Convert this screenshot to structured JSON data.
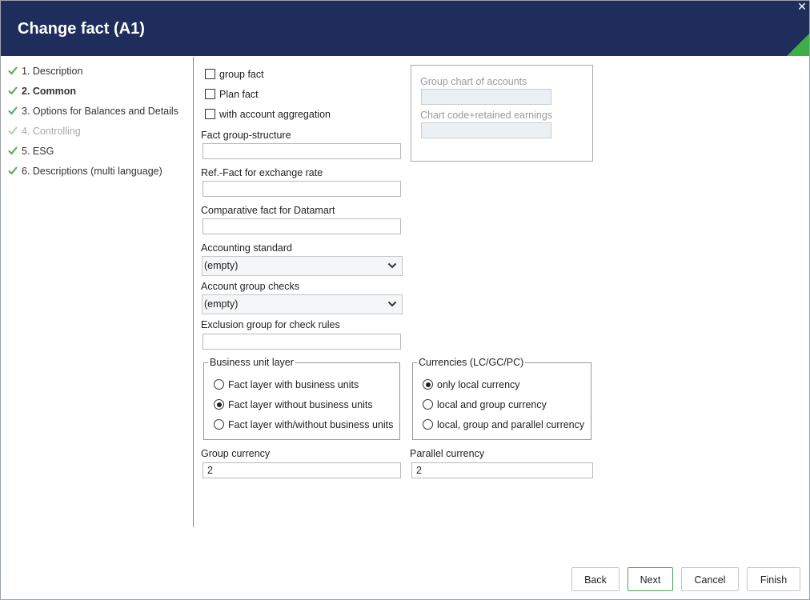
{
  "window": {
    "title": "Change fact (A1)"
  },
  "steps": [
    {
      "label": "1. Description",
      "state": "done"
    },
    {
      "label": "2. Common",
      "state": "active"
    },
    {
      "label": "3. Options for Balances and Details",
      "state": "done"
    },
    {
      "label": "4. Controlling",
      "state": "disabled"
    },
    {
      "label": "5. ESG",
      "state": "done"
    },
    {
      "label": "6. Descriptions (multi language)",
      "state": "done"
    }
  ],
  "checkboxes": {
    "group_fact": {
      "label": "group fact",
      "checked": false
    },
    "plan_fact": {
      "label": "Plan fact",
      "checked": false
    },
    "account_aggregation": {
      "label": "with account aggregation",
      "checked": false
    }
  },
  "fields": {
    "fact_group_structure": {
      "label": "Fact group-structure",
      "value": ""
    },
    "ref_fact_exchange": {
      "label": "Ref.-Fact for exchange rate",
      "value": ""
    },
    "comparative_fact": {
      "label": "Comparative fact for Datamart",
      "value": ""
    },
    "accounting_standard": {
      "label": "Accounting standard",
      "value": "(empty)"
    },
    "account_group_checks": {
      "label": "Account group checks",
      "value": "(empty)"
    },
    "exclusion_group": {
      "label": "Exclusion group for check rules",
      "value": ""
    },
    "group_chart": {
      "label": "Group chart of accounts",
      "value": ""
    },
    "chart_code": {
      "label": "Chart code+retained earnings",
      "value": ""
    },
    "group_currency": {
      "label": "Group currency",
      "value": "2"
    },
    "parallel_currency": {
      "label": "Parallel currency",
      "value": "2"
    }
  },
  "business_unit_layer": {
    "title": "Business unit layer",
    "options": [
      {
        "label": "Fact layer with business units",
        "selected": false
      },
      {
        "label": "Fact layer without business units",
        "selected": true
      },
      {
        "label": "Fact layer with/without business units",
        "selected": false
      }
    ]
  },
  "currencies": {
    "title": "Currencies (LC/GC/PC)",
    "options": [
      {
        "label": "only local currency",
        "selected": true
      },
      {
        "label": "local and group currency",
        "selected": false
      },
      {
        "label": "local, group and parallel currency",
        "selected": false
      }
    ]
  },
  "buttons": {
    "back": "Back",
    "next": "Next",
    "cancel": "Cancel",
    "finish": "Finish"
  },
  "colors": {
    "titlebar": "#1f2d5c",
    "accent": "#3fae49",
    "check": "#4caf50"
  }
}
